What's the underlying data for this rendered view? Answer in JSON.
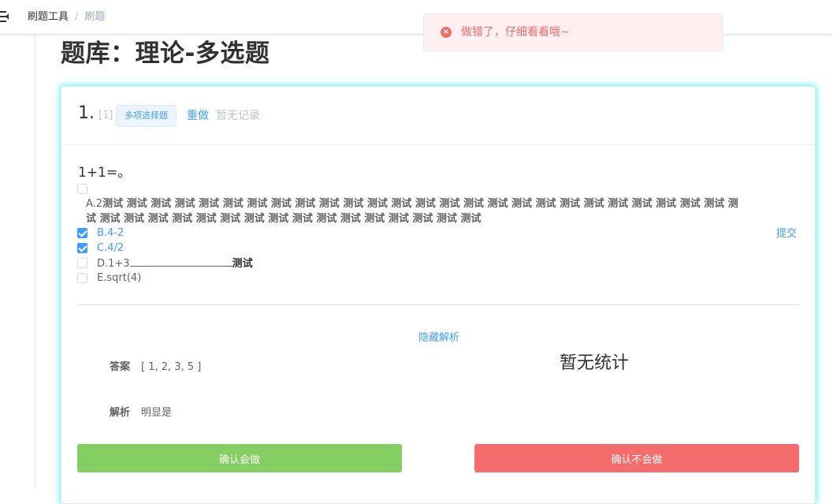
{
  "header": {
    "breadcrumb": [
      "刷题工具",
      "刷题"
    ],
    "separator": "/"
  },
  "toast": {
    "message": "做错了，仔细看看哦~",
    "icon": "error-circle-icon",
    "icon_glyph": "×",
    "type": "error"
  },
  "page": {
    "title": "题库：理论-多选题"
  },
  "question": {
    "number": "1.",
    "id": "[1]",
    "type_tag": "多项选择题",
    "redo_label": "重做",
    "record_text": "暂无记录",
    "stem": "1+1=。",
    "options": [
      {
        "label": "A.2",
        "bold_text": "测试 测试 测试 测试 测试 测试 测试 测试 测试 测试 测试 测试 测试 测试 测试 测试 测试 测试 测试 测试 测试 测试 测试 测试 测试 测试 测试 测试 测试 测试 测试 测试 测试 测试 测试 测试 测试 测试 测试 测试 测试 测试 测试",
        "checked": false
      },
      {
        "label": "B.4-2",
        "checked": true
      },
      {
        "label": "C.4/2",
        "checked": true
      },
      {
        "label": "D.1+3",
        "tail": "测试",
        "checked": false
      },
      {
        "label": "E.sqrt(4)",
        "checked": false
      }
    ],
    "submit_label": "提交"
  },
  "analysis": {
    "toggle_label": "隐藏解析",
    "answer_label": "答案",
    "answer_value": "[ 1, 2, 3, 5 ]",
    "explanation_label": "解析",
    "explanation_value": "明显是",
    "stats_text": "暂无统计"
  },
  "actions": {
    "know_label": "确认会做",
    "dont_know_label": "确认不会做"
  },
  "colors": {
    "accent": "#409eff",
    "success": "#85ce61",
    "danger": "#f56c6c"
  }
}
